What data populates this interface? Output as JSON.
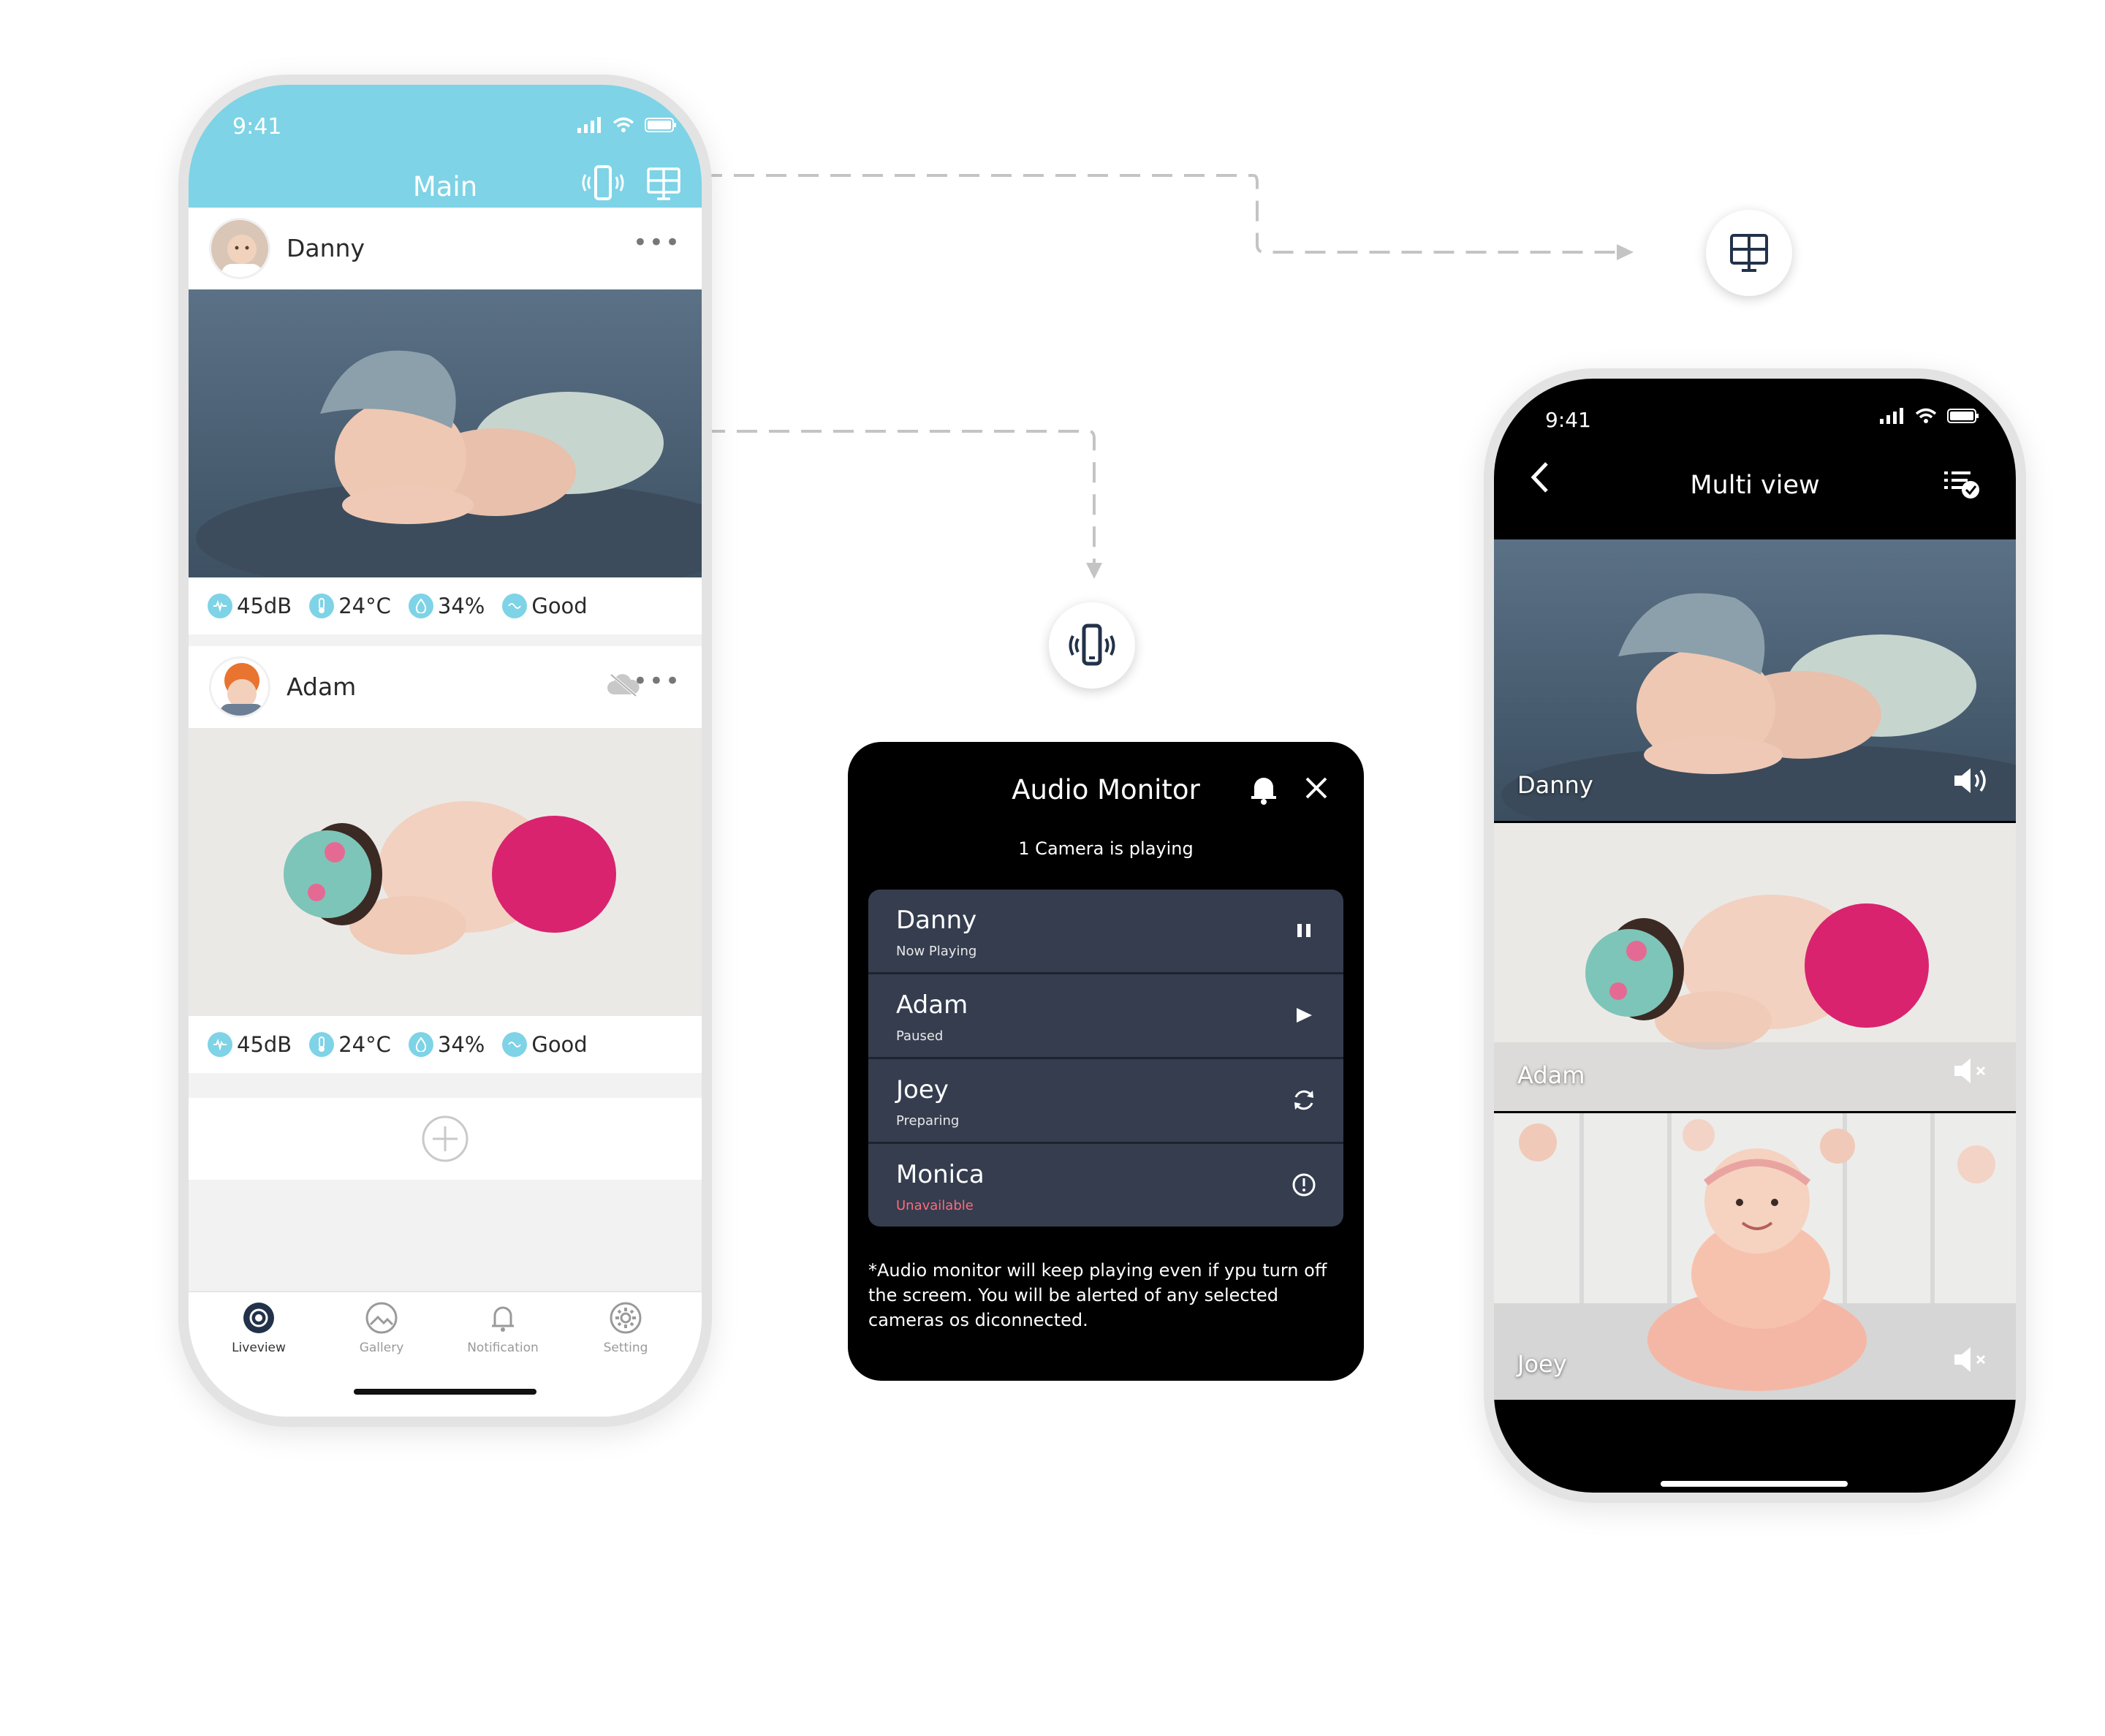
{
  "main_phone": {
    "status_time": "9:41",
    "title": "Main",
    "cameras": [
      {
        "name": "Danny",
        "stats": {
          "sound": "45dB",
          "temp": "24°C",
          "humidity": "34%",
          "air": "Good"
        }
      },
      {
        "name": "Adam",
        "stats": {
          "sound": "45dB",
          "temp": "24°C",
          "humidity": "34%",
          "air": "Good"
        }
      }
    ],
    "tabs": [
      {
        "label": "Liveview",
        "icon": "liveview-icon"
      },
      {
        "label": "Gallery",
        "icon": "gallery-icon"
      },
      {
        "label": "Notification",
        "icon": "bell-icon"
      },
      {
        "label": "Setting",
        "icon": "gear-icon"
      }
    ]
  },
  "audio_monitor": {
    "title": "Audio Monitor",
    "subtitle": "1 Camera  is playing",
    "items": [
      {
        "name": "Danny",
        "state": "Now Playing",
        "action": "pause-icon"
      },
      {
        "name": "Adam",
        "state": "Paused",
        "action": "play-icon"
      },
      {
        "name": "Joey",
        "state": "Preparing",
        "action": "refresh-icon"
      },
      {
        "name": "Monica",
        "state": "Unavailable",
        "action": "alert-icon"
      }
    ],
    "note": "*Audio monitor will keep playing even if ypu turn off the screem. You will be alerted of any selected cameras os diconnected."
  },
  "multi_view_phone": {
    "status_time": "9:41",
    "title": "Multi view",
    "feeds": [
      {
        "name": "Danny",
        "volume": "on"
      },
      {
        "name": "Adam",
        "volume": "muted"
      },
      {
        "name": "Joey",
        "volume": "muted"
      }
    ]
  },
  "colors": {
    "accent": "#7ed3e6",
    "panel_dark": "#353d4f",
    "warning": "#ff6b7a"
  }
}
